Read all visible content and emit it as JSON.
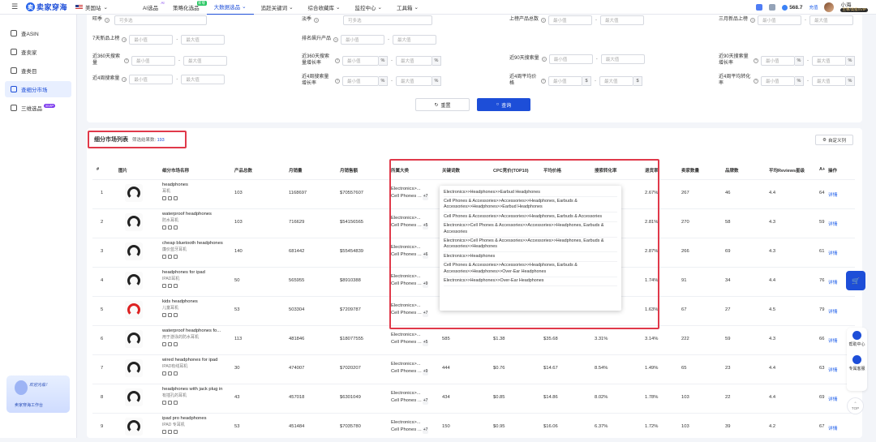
{
  "topbar": {
    "brand": "卖家穿海",
    "site": "美国站",
    "nav": [
      {
        "label": "AI选品",
        "sup": "AI",
        "active": false
      },
      {
        "label": "策略化选品",
        "sup": "新版",
        "active": false
      },
      {
        "label": "大数据选品",
        "sup": "",
        "active": true
      },
      {
        "label": "追赶关键词",
        "sup": "",
        "active": false
      },
      {
        "label": "综合收藏库",
        "sup": "",
        "active": false
      },
      {
        "label": "监控中心",
        "sup": "",
        "active": false
      },
      {
        "label": "工具箱",
        "sup": "",
        "active": false
      }
    ],
    "balance": "568.7",
    "recharge": "充值",
    "username": "小海",
    "vip": "至尊/高级SVIP"
  },
  "sidebar": {
    "items": [
      {
        "label": "查ASIN",
        "badge": ""
      },
      {
        "label": "查卖家",
        "badge": ""
      },
      {
        "label": "查类目",
        "badge": ""
      },
      {
        "label": "查细分市场",
        "badge": ""
      },
      {
        "label": "三维选品",
        "badge": "SVIP"
      }
    ],
    "card_greeting": "欢迎光临！",
    "card_action": "卖家穿海工作台"
  },
  "filters": {
    "row0": [
      {
        "label": "旺季",
        "placeholder": "可多选",
        "type": "select"
      },
      {
        "label": "淡季",
        "placeholder": "可多选",
        "type": "select"
      },
      {
        "label": "上榜产品总数",
        "min": "最小值",
        "max": "最大值"
      },
      {
        "label": "三月新品上榜",
        "min": "最小值",
        "max": "最大值"
      }
    ],
    "row1": [
      {
        "label": "7天新品上榜",
        "min": "最小值",
        "max": "最大值"
      },
      {
        "label": "排名飙升产品",
        "min": "最小值",
        "max": "最大值"
      }
    ],
    "row2": [
      {
        "label": "近360天搜索量",
        "min": "最小值",
        "max": "最大值"
      },
      {
        "label": "近360天搜索量增长率",
        "min": "最小值",
        "max": "最大值",
        "unit": "%"
      },
      {
        "label": "近90天搜索量",
        "min": "最小值",
        "max": "最大值"
      },
      {
        "label": "近90天搜索量增长率",
        "min": "最小值",
        "max": "最大值",
        "unit": "%"
      }
    ],
    "row3": [
      {
        "label": "近4周搜索量",
        "min": "最小值",
        "max": "最大值"
      },
      {
        "label": "近4周搜索量增长率",
        "min": "最小值",
        "max": "最大值",
        "unit": "%"
      },
      {
        "label": "近4周平均价格",
        "min": "最小值",
        "max": "最大值",
        "unit": "$"
      },
      {
        "label": "近4周平均转化率",
        "min": "最小值",
        "max": "最大值",
        "unit": "%"
      }
    ],
    "reset": "重置",
    "query": "查询"
  },
  "table": {
    "title": "细分市场列表",
    "count_label": "筛选结果数:",
    "count": "193",
    "custom_columns": "自定义列",
    "headers": [
      "#",
      "图片",
      "细分市场名称",
      "产品总数",
      "月销量",
      "月销售额",
      "所属大类",
      "关键词数",
      "CPC竞价(TOP10)",
      "平均价格",
      "搜索转化率",
      "退货率",
      "卖家数量",
      "品牌数",
      "平均Reviews星级",
      "A+",
      "操作"
    ],
    "rows": [
      {
        "idx": "1",
        "en": "headphones",
        "zh": "耳机",
        "total": "103",
        "units": "1168697",
        "revenue": "$70557607",
        "cat1": "Electronics>...",
        "cat2": "Cell Phones ...",
        "more": "+7",
        "kw": "",
        "cpc": "",
        "price": "",
        "conv": "",
        "ret": "2.67%",
        "sellers": "267",
        "brands": "46",
        "stars": "4.4",
        "aplus": "64",
        "op": "详情"
      },
      {
        "idx": "2",
        "en": "waterproof headphones",
        "zh": "防水耳机",
        "total": "103",
        "units": "716629",
        "revenue": "$54156565",
        "cat1": "Electronics>...",
        "cat2": "Cell Phones ...",
        "more": "+5",
        "kw": "",
        "cpc": "",
        "price": "",
        "conv": "",
        "ret": "2.81%",
        "sellers": "270",
        "brands": "58",
        "stars": "4.3",
        "aplus": "59",
        "op": "详情"
      },
      {
        "idx": "3",
        "en": "cheap bluetooth headphones",
        "zh": "廉价蓝牙耳机",
        "total": "140",
        "units": "681442",
        "revenue": "$55454839",
        "cat1": "Electronics>...",
        "cat2": "Cell Phones ...",
        "more": "+6",
        "kw": "",
        "cpc": "",
        "price": "",
        "conv": "",
        "ret": "2.87%",
        "sellers": "266",
        "brands": "69",
        "stars": "4.3",
        "aplus": "61",
        "op": "详情"
      },
      {
        "idx": "4",
        "en": "headphones for ipad",
        "zh": "IPAD耳机",
        "total": "50",
        "units": "565955",
        "revenue": "$8910388",
        "cat1": "Electronics>...",
        "cat2": "Cell Phones ...",
        "more": "+9",
        "kw": "",
        "cpc": "",
        "price": "",
        "conv": "",
        "ret": "1.74%",
        "sellers": "91",
        "brands": "34",
        "stars": "4.4",
        "aplus": "76",
        "op": "详情"
      },
      {
        "idx": "5",
        "en": "kids headphones",
        "zh": "儿童耳机",
        "total": "53",
        "units": "503304",
        "revenue": "$7209787",
        "cat1": "Electronics>...",
        "cat2": "Cell Phones ...",
        "more": "+7",
        "kw": "",
        "cpc": "",
        "price": "",
        "conv": "",
        "ret": "1.63%",
        "sellers": "67",
        "brands": "27",
        "stars": "4.5",
        "aplus": "79",
        "op": "详情"
      },
      {
        "idx": "6",
        "en": "waterproof headphones fo...",
        "zh": "用于游泳的防水耳机",
        "total": "113",
        "units": "481846",
        "revenue": "$18077555",
        "cat1": "Electronics>...",
        "cat2": "Cell Phones ...",
        "more": "+5",
        "kw": "585",
        "cpc": "$1.38",
        "price": "$35.68",
        "conv": "3.31%",
        "ret": "3.14%",
        "sellers": "222",
        "brands": "59",
        "stars": "4.3",
        "aplus": "66",
        "op": "详情"
      },
      {
        "idx": "7",
        "en": "wired headphones for ipad",
        "zh": "IPAD有线耳机",
        "total": "30",
        "units": "474007",
        "revenue": "$7020207",
        "cat1": "Electronics>...",
        "cat2": "Cell Phones ...",
        "more": "+9",
        "kw": "444",
        "cpc": "$0.76",
        "price": "$14.67",
        "conv": "8.54%",
        "ret": "1.49%",
        "sellers": "65",
        "brands": "23",
        "stars": "4.4",
        "aplus": "63",
        "op": "详情"
      },
      {
        "idx": "8",
        "en": "headphones with jack plug in",
        "zh": "有插孔的耳机",
        "total": "43",
        "units": "457018",
        "revenue": "$6301049",
        "cat1": "Electronics>...",
        "cat2": "Cell Phones ...",
        "more": "+7",
        "kw": "434",
        "cpc": "$0.85",
        "price": "$14.86",
        "conv": "8.02%",
        "ret": "1.78%",
        "sellers": "103",
        "brands": "22",
        "stars": "4.4",
        "aplus": "69",
        "op": "详情"
      },
      {
        "idx": "9",
        "en": "ipad pro headphones",
        "zh": "IPAD 专耳机",
        "total": "53",
        "units": "451484",
        "revenue": "$7035780",
        "cat1": "Electronics>...",
        "cat2": "Cell Phones ...",
        "more": "+7",
        "kw": "150",
        "cpc": "$0.95",
        "price": "$16.06",
        "conv": "6.37%",
        "ret": "1.72%",
        "sellers": "103",
        "brands": "39",
        "stars": "4.2",
        "aplus": "67",
        "op": "详情"
      }
    ],
    "popover": [
      "Electronics>>Headphones>>Earbud Headphones",
      "Cell Phones & Accessories>>Accessories>>Headphones, Earbuds & Accessories>>Headphones>>Earbud Headphones",
      "Cell Phones & Accessories>>Accessories>>Headphones, Earbuds & Accessories",
      "Electronics>>Cell Phones & Accessories>>Accessories>>Headphones, Earbuds & Accessories",
      "Electronics>>Cell Phones & Accessories>>Accessories>>Headphones, Earbuds & Accessories>>Headphones",
      "Electronics>>Headphones",
      "Cell Phones & Accessories>>Accessories>>Headphones, Earbuds & Accessories>>Headphones>>Over-Ear Headphones",
      "Electronics>>Headphones>>Over-Ear Headphones"
    ]
  },
  "floats": {
    "help": "帮助中心",
    "service": "专属客服",
    "top": "TOP"
  }
}
